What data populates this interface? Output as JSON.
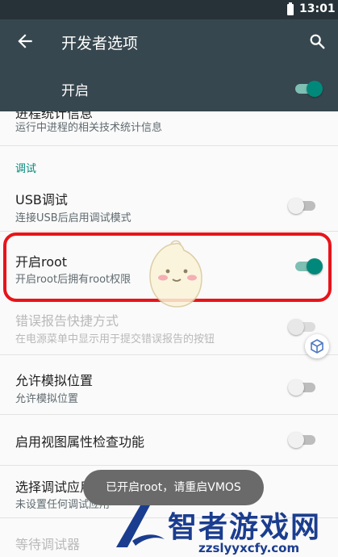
{
  "status_bar": {
    "time": "13:01"
  },
  "toolbar": {
    "title": "开发者选项"
  },
  "master": {
    "label": "开启",
    "on": true
  },
  "list": {
    "partial_item": {
      "title": "进程统计信息",
      "summary": "运行中进程的相关技术统计信息"
    },
    "section_debug": "调试",
    "usb_debug": {
      "title": "USB调试",
      "summary": "连接USB后启用调试模式",
      "on": false
    },
    "root": {
      "title": "开启root",
      "summary": "开启root后拥有root权限",
      "on": true
    },
    "bug_report": {
      "title": "错误报告快捷方式",
      "summary": "在电源菜单中显示用于提交错误报告的按钮",
      "on": false,
      "disabled": true
    },
    "mock_location": {
      "title": "允许模拟位置",
      "summary": "允许模拟位置",
      "on": false
    },
    "view_attr": {
      "title": "启用视图属性检查功能",
      "on": false
    },
    "debug_app": {
      "title": "选择调试应用",
      "summary": "未设置任何调试应用"
    },
    "wait_debugger": {
      "title": "等待调试器"
    }
  },
  "toast": {
    "text": "已开启root，请重启VMOS"
  },
  "watermark": {
    "brand": "智者游戏网",
    "url": "zzslyyxcfy.com"
  },
  "colors": {
    "accent": "#00897b",
    "toolbar": "#37474f",
    "highlight": "#e8141a"
  }
}
